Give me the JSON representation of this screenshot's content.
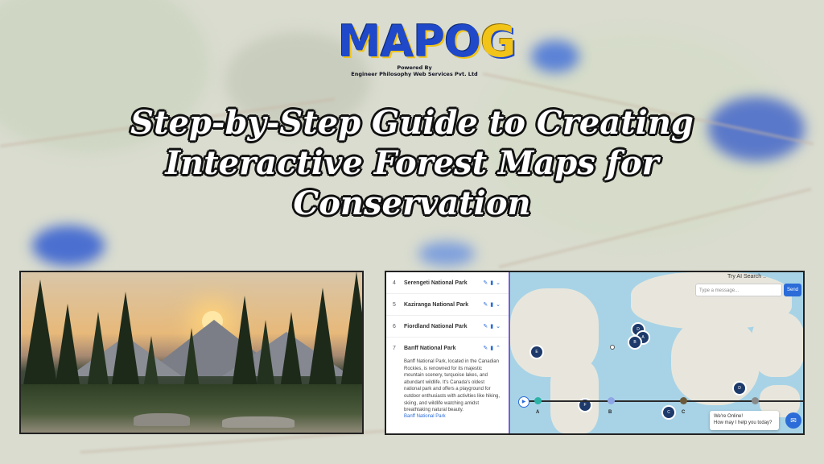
{
  "logo": {
    "word_main": "MAPO",
    "word_end": "G",
    "powered": "Powered By",
    "company": "Engineer Philosophy Web Services Pvt. Ltd"
  },
  "headline": {
    "line1": "Step-by-Step Guide to Creating",
    "line2": "Interactive Forest Maps for",
    "line3": "Conservation"
  },
  "app": {
    "search_title": "Try AI Search ..",
    "chat_placeholder": "Type a message...",
    "send_label": "Send",
    "items": [
      {
        "num": "4",
        "name": "Serengeti National Park"
      },
      {
        "num": "5",
        "name": "Kaziranga National Park"
      },
      {
        "num": "6",
        "name": "Fiordland National Park"
      },
      {
        "num": "7",
        "name": "Banff National Park"
      }
    ],
    "expanded_description": "Banff National Park, located in the Canadian Rockies, is renowned for its majestic mountain scenery, turquoise lakes, and abundant wildlife. It's Canada's oldest national park and offers a playground for outdoor enthusiasts with activities like hiking, skiing, and wildlife watching amidst breathtaking natural beauty.",
    "expanded_link": "Banff National Park",
    "clusters": [
      "E",
      "D",
      "A",
      "B",
      "F",
      "C",
      "D"
    ],
    "timeline_labels": [
      "A",
      "B",
      "C"
    ],
    "online_title": "We're Online!",
    "online_sub": "How may I help you today?"
  },
  "colors": {
    "accent": "#2b6cd8",
    "panel_divider": "#7a5fd0",
    "ocean": "#a8d3e6",
    "cluster": "#1d3a6b"
  }
}
